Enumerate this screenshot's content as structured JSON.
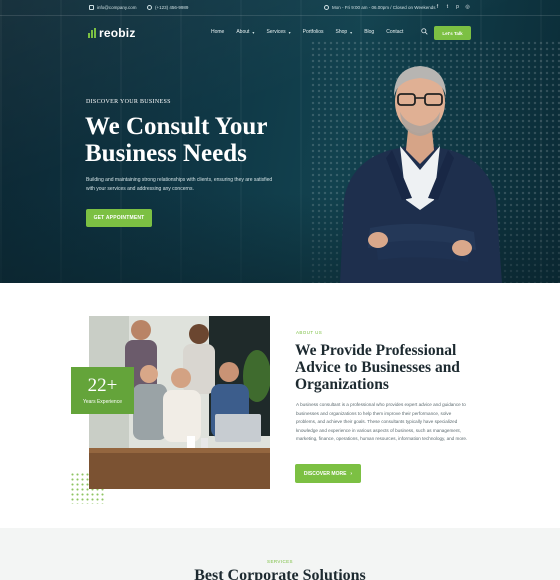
{
  "topbar": {
    "email": "info@company.com",
    "phone": "(+123) 456-9989",
    "hours": "Mon - Fri 9:00 am - 06.00pm / Closed on Weekends",
    "social": [
      {
        "icon": "facebook-icon",
        "glyph": "f"
      },
      {
        "icon": "twitter-icon",
        "glyph": "t"
      },
      {
        "icon": "pinterest-icon",
        "glyph": "p"
      },
      {
        "icon": "instagram-icon",
        "glyph": "◎"
      }
    ]
  },
  "header": {
    "logo_text": "reobiz",
    "nav": [
      {
        "label": "Home",
        "dropdown": false
      },
      {
        "label": "About",
        "dropdown": true
      },
      {
        "label": "Services",
        "dropdown": true
      },
      {
        "label": "Portfolios",
        "dropdown": false
      },
      {
        "label": "Shop",
        "dropdown": true
      },
      {
        "label": "Blog",
        "dropdown": false
      },
      {
        "label": "Contact",
        "dropdown": false
      }
    ],
    "cta_label": "Let's Talk"
  },
  "hero": {
    "eyebrow": "DISCOVER YOUR BUSINESS",
    "title_line1": "We Consult Your",
    "title_line2": "Business Needs",
    "description": "Building and maintaining strong relationships with clients, ensuring they are satisfied with your services and addressing any concerns.",
    "button_label": "GET APPOINTMENT"
  },
  "about": {
    "experience_number": "22+",
    "experience_label": "Years Experience",
    "eyebrow": "ABOUT US",
    "title": "We Provide Professional Advice to Businesses and Organizations",
    "description": "A business consultant is a professional who provides expert advice and guidance to businesses and organizations to help them improve their performance, solve problems, and achieve their goals. These consultants typically have specialized knowledge and experience in various aspects of business, such as management, marketing, finance, operations, human resources, information technology, and more.",
    "button_label": "DISCOVER MORE",
    "button_arrow": "›"
  },
  "services": {
    "eyebrow": "SERVICES",
    "title": "Best Corporate Solutions"
  },
  "colors": {
    "accent": "#7cc043",
    "accent_dark": "#64a43a",
    "hero_bg": "#0f3644",
    "heading": "#1d2a30"
  }
}
